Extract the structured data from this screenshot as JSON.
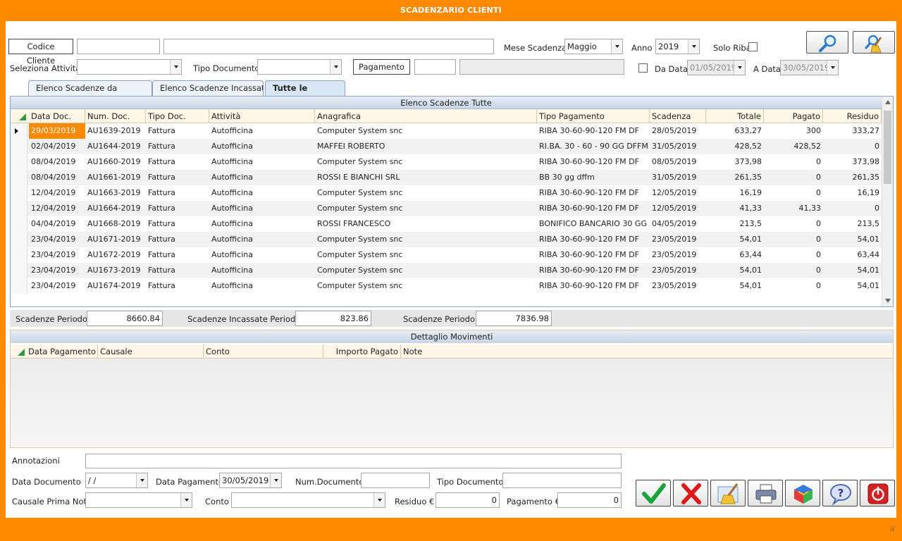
{
  "window": {
    "title": "SCADENZARIO CLIENTI"
  },
  "filters": {
    "codice_cliente_label": "Codice Cliente",
    "codice_cliente_value": "",
    "cliente_nome_value": "",
    "mese_label": "Mese Scadenza",
    "mese_value": "Maggio",
    "anno_label": "Anno",
    "anno_value": "2019",
    "solo_riba_label": "Solo Riba",
    "attivita_label": "Seleziona Attività",
    "attivita_value": "",
    "tipo_doc_label": "Tipo Documento",
    "tipo_doc_value": "",
    "pagamento_label": "Pagamento",
    "pagamento_code": "",
    "pagamento_desc": "",
    "da_data_label": "Da Data",
    "da_data_value": "01/05/2019",
    "a_data_label": "A Data",
    "a_data_value": "30/05/2019"
  },
  "tabs": [
    {
      "label": "Elenco Scadenze da Incassare"
    },
    {
      "label": "Elenco Scadenze Incassate"
    },
    {
      "label": "Tutte le Scadenze"
    }
  ],
  "grid": {
    "title": "Elenco Scadenze Tutte",
    "columns": [
      "Data Doc.",
      "Num. Doc.",
      "Tipo Doc.",
      "Attività",
      "Anagrafica",
      "Tipo Pagamento",
      "Scadenza",
      "Totale",
      "Pagato",
      "Residuo"
    ],
    "rows": [
      [
        "29/03/2019",
        "AU1639-2019",
        "Fattura",
        "Autofficina",
        "Computer System snc",
        "RIBA 30-60-90-120 FM DF",
        "28/05/2019",
        "633,27",
        "300",
        "333,27"
      ],
      [
        "02/04/2019",
        "AU1644-2019",
        "Fattura",
        "Autofficina",
        "MAFFEI ROBERTO",
        "RI.BA. 30 - 60 - 90 GG DFFM",
        "31/05/2019",
        "428,52",
        "428,52",
        "0"
      ],
      [
        "08/04/2019",
        "AU1660-2019",
        "Fattura",
        "Autofficina",
        "Computer System snc",
        "RIBA 30-60-90-120 FM DF",
        "08/05/2019",
        "373,98",
        "0",
        "373,98"
      ],
      [
        "08/04/2019",
        "AU1661-2019",
        "Fattura",
        "Autofficina",
        "ROSSI E BIANCHI SRL",
        "BB 30 gg dffm",
        "31/05/2019",
        "261,35",
        "0",
        "261,35"
      ],
      [
        "12/04/2019",
        "AU1663-2019",
        "Fattura",
        "Autofficina",
        "Computer System snc",
        "RIBA 30-60-90-120 FM DF",
        "12/05/2019",
        "16,19",
        "0",
        "16,19"
      ],
      [
        "12/04/2019",
        "AU1664-2019",
        "Fattura",
        "Autofficina",
        "Computer System snc",
        "RIBA 30-60-90-120 FM DF",
        "12/05/2019",
        "41,33",
        "41,33",
        "0"
      ],
      [
        "04/04/2019",
        "AU1668-2019",
        "Fattura",
        "Autofficina",
        "ROSSI FRANCESCO",
        "BONIFICO BANCARIO 30 GG",
        "04/05/2019",
        "213,5",
        "0",
        "213,5"
      ],
      [
        "23/04/2019",
        "AU1671-2019",
        "Fattura",
        "Autofficina",
        "Computer System snc",
        "RIBA 30-60-90-120 FM DF",
        "23/05/2019",
        "54,01",
        "0",
        "54,01"
      ],
      [
        "23/04/2019",
        "AU1672-2019",
        "Fattura",
        "Autofficina",
        "Computer System snc",
        "RIBA 30-60-90-120 FM DF",
        "23/05/2019",
        "63,44",
        "0",
        "63,44"
      ],
      [
        "23/04/2019",
        "AU1673-2019",
        "Fattura",
        "Autofficina",
        "Computer System snc",
        "RIBA 30-60-90-120 FM DF",
        "23/05/2019",
        "54,01",
        "0",
        "54,01"
      ],
      [
        "23/04/2019",
        "AU1674-2019",
        "Fattura",
        "Autofficina",
        "Computer System snc",
        "RIBA 30-60-90-120 FM DF",
        "23/05/2019",
        "54,01",
        "0",
        "54,01"
      ]
    ]
  },
  "summary": {
    "periodo_label": "Scadenze Periodo",
    "periodo_value": "8660.84",
    "incassate_label": "Scadenze Incassate Periodo",
    "incassate_value": "823.86",
    "residuo_label": "Scadenze Periodo",
    "residuo_value": "7836.98"
  },
  "detail": {
    "title": "Dettaglio Movimenti",
    "columns": [
      "Data Pagamento",
      "Causale",
      "Conto",
      "Importo Pagato",
      "Note"
    ]
  },
  "form": {
    "annotazioni_label": "Annotazioni",
    "annotazioni_value": "",
    "data_documento_label": "Data Documento",
    "data_documento_value": " /  /",
    "data_pagamento_label": "Data Pagamento",
    "data_pagamento_value": "30/05/2019",
    "num_documento_label": "Num.Documento",
    "num_documento_value": "",
    "tipo_documento_label": "Tipo Documento",
    "tipo_documento_value": "",
    "causale_label": "Causale Prima Nota",
    "causale_value": "",
    "conto_label": "Conto",
    "conto_value": "",
    "residuo_label": "Residuo €",
    "residuo_value": "0",
    "pagamento_label": "Pagamento €",
    "pagamento_value": "0"
  },
  "colors": {
    "accent": "#ff8a00",
    "selection": "#ff8a00",
    "grid_header": "#fff6e8"
  }
}
